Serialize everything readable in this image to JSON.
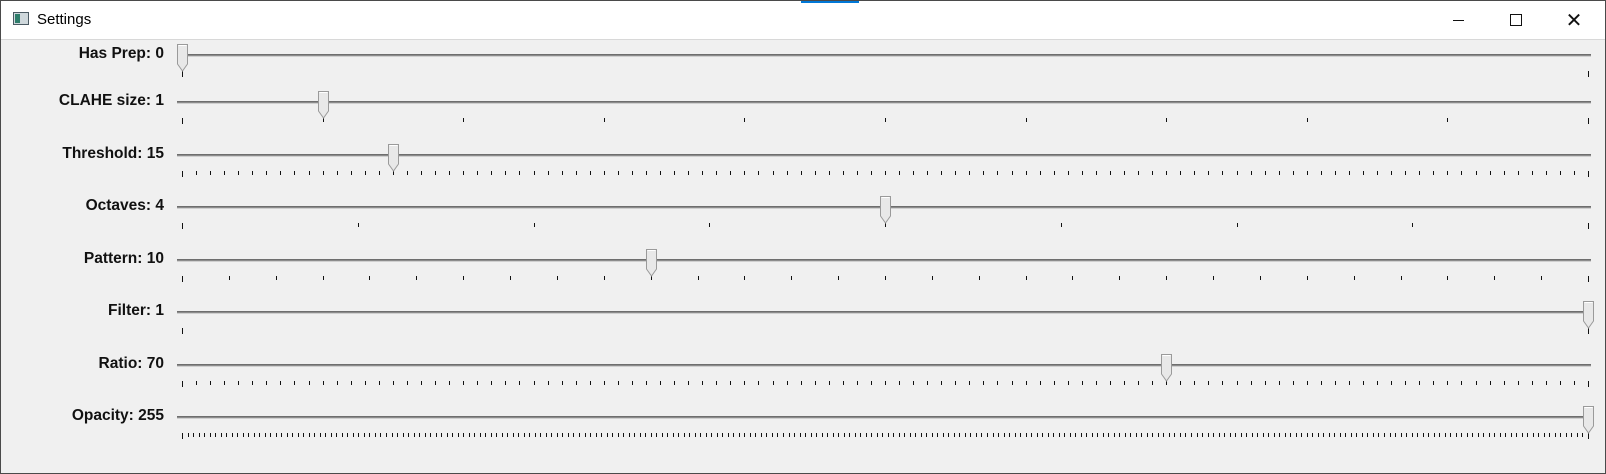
{
  "window": {
    "title": "Settings",
    "controls": {
      "minimize": "─",
      "maximize": "□",
      "close": "✕"
    }
  },
  "sliders": [
    {
      "label": "Has Prep: 0",
      "value": 0,
      "max": 1
    },
    {
      "label": "CLAHE size: 1",
      "value": 1,
      "max": 10
    },
    {
      "label": "Threshold: 15",
      "value": 15,
      "max": 100
    },
    {
      "label": "Octaves: 4",
      "value": 4,
      "max": 8
    },
    {
      "label": "Pattern: 10",
      "value": 10,
      "max": 30
    },
    {
      "label": "Filter: 1",
      "value": 1,
      "max": 1
    },
    {
      "label": "Ratio: 70",
      "value": 70,
      "max": 100
    },
    {
      "label": "Opacity: 255",
      "value": 255,
      "max": 255
    }
  ],
  "colors": {
    "accent": "#0078d7",
    "track": "#8c8c8c",
    "background": "#f0f0f0"
  }
}
